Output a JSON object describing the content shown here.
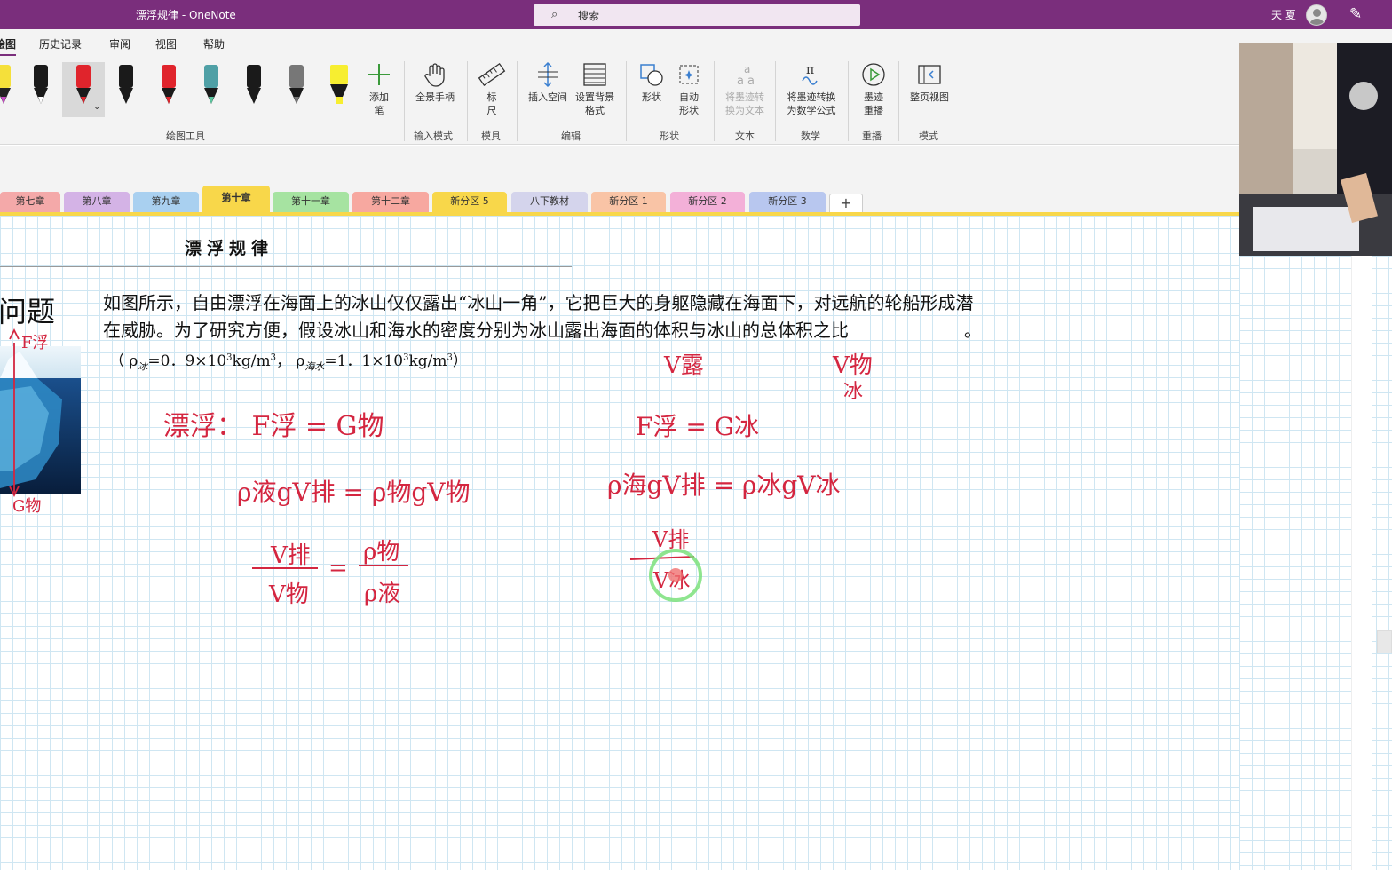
{
  "window": {
    "doc_title": "漂浮规律  -  OneNote",
    "search_placeholder": "搜索",
    "user_name": "天 夏"
  },
  "menu": {
    "tabs": [
      "绘图",
      "历史记录",
      "审阅",
      "视图",
      "帮助"
    ]
  },
  "ribbon": {
    "add_pen": "添加\n笔",
    "full_hand": "全景手柄",
    "ruler": "标\n尺",
    "insert_space": "插入空间",
    "page_format": "设置背景\n格式",
    "shapes": "形状",
    "auto_shape": "自动\n形状",
    "ink_to_text": "将墨迹转\n换为文本",
    "ink_to_math": "将墨迹转换\n为数学公式",
    "ink_replay": "墨迹\n重播",
    "page_view": "整页视图",
    "groups": {
      "drawing_tools": "绘图工具",
      "input_mode": "输入模式",
      "stencils": "模具",
      "edit": "编辑",
      "shapes": "形状",
      "text": "文本",
      "math": "数学",
      "replay": "重播",
      "mode": "模式"
    }
  },
  "sections": [
    {
      "label": "第七章",
      "color": "#f4a9a9"
    },
    {
      "label": "第八章",
      "color": "#d4b3e6"
    },
    {
      "label": "第九章",
      "color": "#a9d0f0"
    },
    {
      "label": "第十章",
      "color": "#f8d74a",
      "active": true
    },
    {
      "label": "第十一章",
      "color": "#a6e3a1"
    },
    {
      "label": "第十二章",
      "color": "#f7a8a0"
    },
    {
      "label": "新分区 5",
      "color": "#f8d74a"
    },
    {
      "label": "八下教材",
      "color": "#d4d4ec"
    },
    {
      "label": "新分区 1",
      "color": "#f9c4a6"
    },
    {
      "label": "新分区 2",
      "color": "#f3b0d8"
    },
    {
      "label": "新分区 3",
      "color": "#b8c7ef"
    }
  ],
  "page": {
    "title": "漂浮规律",
    "side_heading": "角问题",
    "question_line1": "如图所示，自由漂浮在海面上的冰山仅仅露出“冰山一角”，它把巨大的身躯隐藏在海面下，对远航的轮船形成潜",
    "question_line2a": "在威胁。为了研究方便，假设冰山和海水的密度分别为冰山露出海面的体积与冰山的总体积之比",
    "question_line2b": "。",
    "formula_open": "（ ρ",
    "rho_ice_sub": "冰",
    "rho_ice_val": "=0．9×10",
    "exp3a": "3",
    "unit_a": "kg/m",
    "exp3b": "3",
    "comma": "，  ρ",
    "rho_sea_sub": "海水",
    "rho_sea_val": "=1．1×10",
    "exp3c": "3",
    "unit_b": "kg/m",
    "exp3d": "3",
    "formula_close": "）"
  },
  "ink": {
    "f_float_label": "F浮",
    "g_obj_label": "G物",
    "line1": "漂浮：  F浮   =   G物",
    "line2": "ρ液gV排  =  ρ物gV物",
    "frac_left_num": "V排",
    "frac_left_den": "V物",
    "frac_right_num": "ρ物",
    "frac_right_den": "ρ液",
    "v_exposed": "V露",
    "v_obj": "V物",
    "ice": "冰",
    "right_eq1": "F浮 =  G冰",
    "right_eq2": "ρ海gV排 = ρ冰gV冰",
    "right_frac_num": "V排",
    "right_frac_den": "V冰"
  },
  "colors": {
    "titlebar": "#7a2e7c",
    "ink_red": "#d42640",
    "grid": "#cfe6f2",
    "active_section": "#f8d74a"
  }
}
